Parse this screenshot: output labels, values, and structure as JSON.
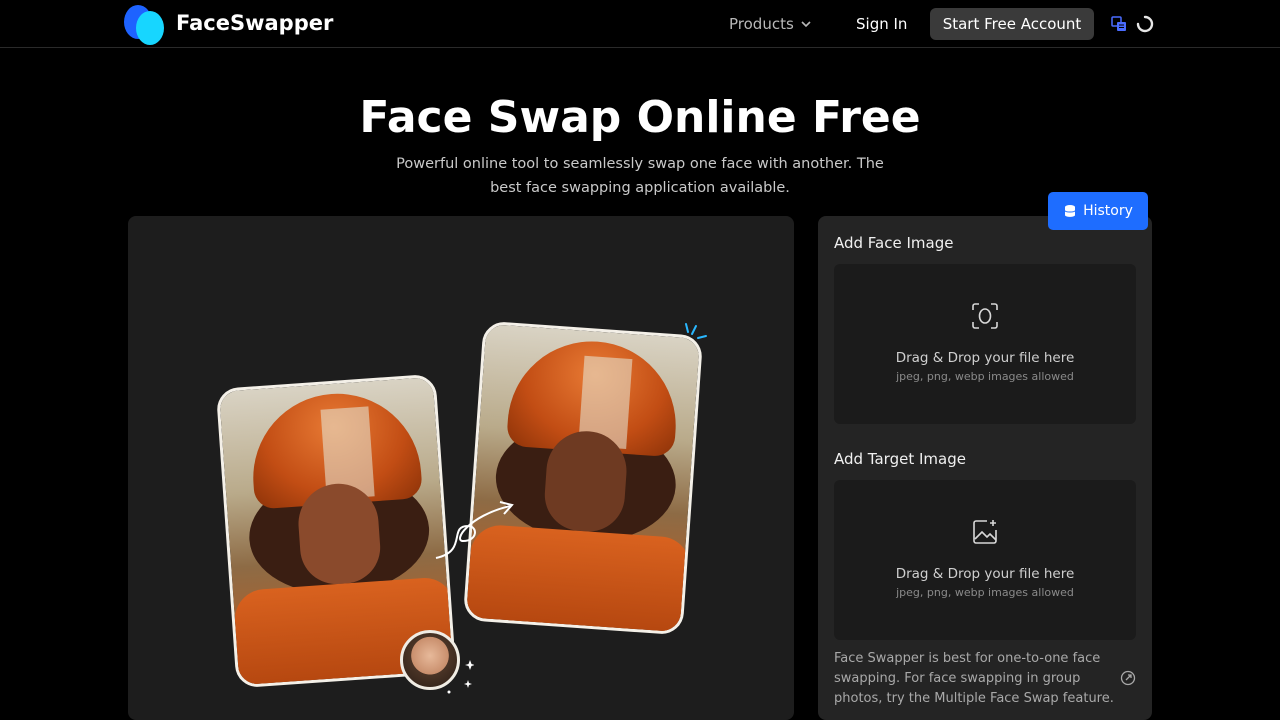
{
  "header": {
    "brand": "FaceSwapper",
    "nav_products": "Products",
    "sign_in": "Sign In",
    "start_account": "Start Free Account"
  },
  "hero": {
    "title": "Face Swap Online Free",
    "subtitle": "Powerful online tool to seamlessly swap one face with another. The best face swapping application available."
  },
  "panel": {
    "history_label": "History",
    "face": {
      "label": "Add Face Image",
      "drop_text": "Drag & Drop your file here",
      "formats": "jpeg, png, webp images allowed",
      "icon": "face-scan-icon"
    },
    "target": {
      "label": "Add Target Image",
      "drop_text": "Drag & Drop your file here",
      "formats": "jpeg, png, webp images allowed",
      "icon": "image-add-icon"
    },
    "note": "Face Swapper is best for one-to-one face swapping. For face swapping in group photos, try the Multiple Face Swap feature."
  },
  "colors": {
    "accent": "#1e6dff",
    "logo_blue": "#1e63ff",
    "logo_cyan": "#17d6ff"
  }
}
